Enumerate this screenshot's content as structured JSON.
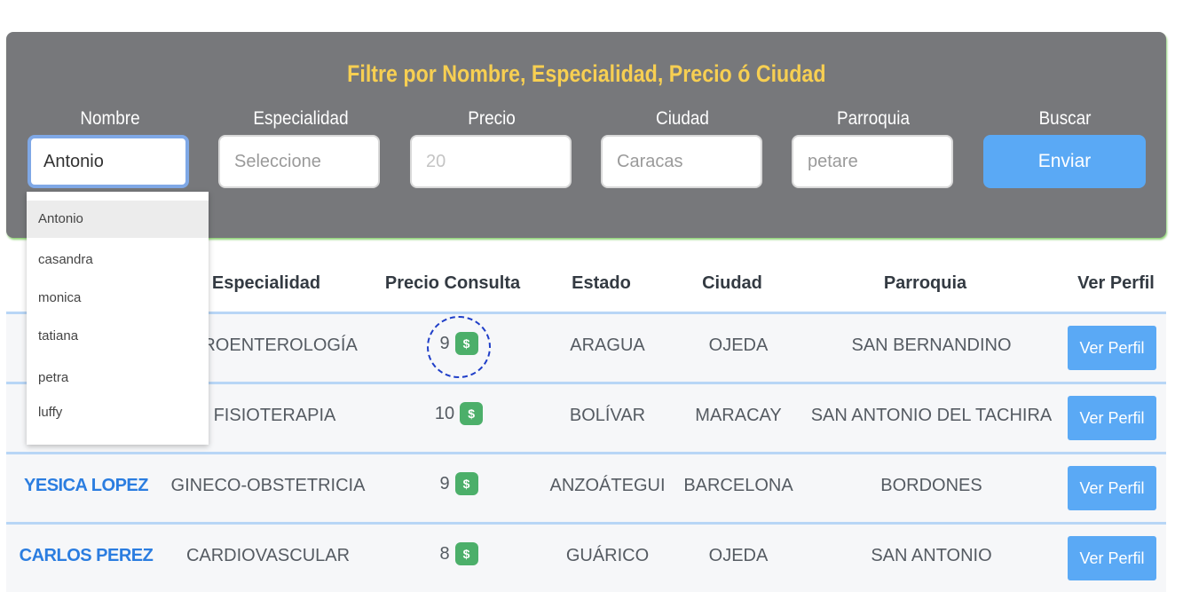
{
  "filter": {
    "title": "Filtre por Nombre, Especialidad, Precio ó Ciudad",
    "labels": {
      "nombre": "Nombre",
      "especialidad": "Especialidad",
      "precio": "Precio",
      "ciudad": "Ciudad",
      "parroquia": "Parroquia",
      "buscar": "Buscar"
    },
    "inputs": {
      "nombre_value": "Antonio",
      "especialidad_placeholder": "Seleccione",
      "precio_placeholder": "20",
      "ciudad_placeholder": "Caracas",
      "parroquia_placeholder": "petare"
    },
    "submit_label": "Enviar"
  },
  "autocomplete": {
    "options": [
      "Antonio",
      "casandra",
      "monica",
      "tatiana",
      "petra",
      "luffy"
    ],
    "selected": "Antonio"
  },
  "table": {
    "headers": {
      "especialidad": "Especialidad",
      "precio": "Precio Consulta",
      "estado": "Estado",
      "ciudad": "Ciudad",
      "parroquia": "Parroquia",
      "perfil": "Ver Perfil"
    },
    "rows": [
      {
        "name": "",
        "especialidad": "TROENTEROLOGÍA",
        "precio": "9",
        "estado": "ARAGUA",
        "ciudad": "OJEDA",
        "parroquia": "SAN BERNANDINO",
        "action": "Ver Perfil"
      },
      {
        "name": "",
        "especialidad": "FISIOTERAPIA",
        "precio": "10",
        "estado": "BOLÍVAR",
        "ciudad": "MARACAY",
        "parroquia": "SAN ANTONIO DEL TACHIRA",
        "action": "Ver Perfil"
      },
      {
        "name": "YESICA LOPEZ",
        "especialidad": "GINECO-OBSTETRICIA",
        "precio": "9",
        "estado": "ANZOÁTEGUI",
        "ciudad": "BARCELONA",
        "parroquia": "BORDONES",
        "action": "Ver Perfil"
      },
      {
        "name": "CARLOS PEREZ",
        "especialidad": "CARDIOVASCULAR",
        "precio": "8",
        "estado": "GUÁRICO",
        "ciudad": "OJEDA",
        "parroquia": "SAN ANTONIO",
        "action": "Ver Perfil"
      }
    ],
    "currency_icon": "$"
  },
  "colors": {
    "accent": "#5aa9f5",
    "title": "#f7cf52",
    "panel": "#77787b",
    "name_link": "#2b7de0",
    "currency_badge": "#4caf6a"
  }
}
